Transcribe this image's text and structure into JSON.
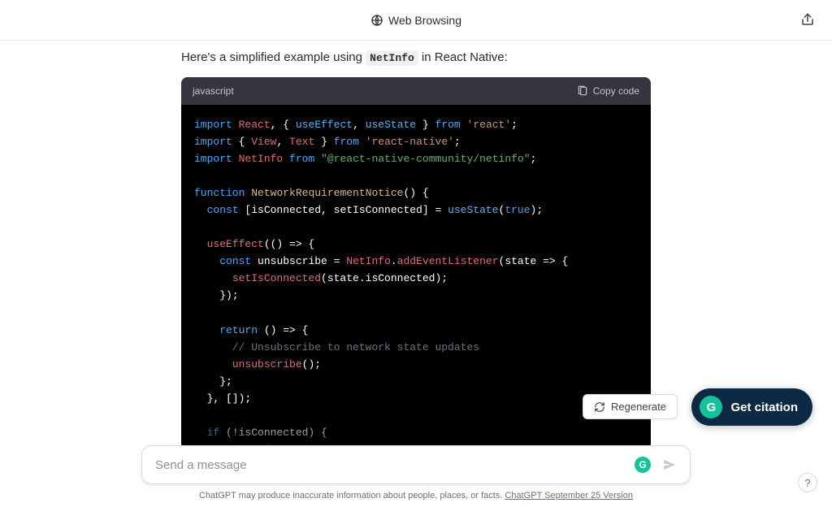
{
  "header": {
    "title": "Web Browsing"
  },
  "message": {
    "intro_pre": "Here's a simplified example using ",
    "intro_code": "NetInfo",
    "intro_post": " in React Native:"
  },
  "codeblock": {
    "language": "javascript",
    "copy_label": "Copy code",
    "lines": {
      "l1_kw_import": "import",
      "l1_react": "React",
      "l1_comma": ", { ",
      "l1_useeffect": "useEffect",
      "l1_sep1": ", ",
      "l1_usestate": "useState",
      "l1_close": " } ",
      "l1_kw_from": "from",
      "l1_str": "'react'",
      "l1_semi": ";",
      "l2_kw_import": "import",
      "l2_open": " { ",
      "l2_view": "View",
      "l2_sep": ", ",
      "l2_text": "Text",
      "l2_close": " } ",
      "l2_kw_from": "from",
      "l2_str": "'react-native'",
      "l2_semi": ";",
      "l3_kw_import": "import",
      "l3_sp": " ",
      "l3_netinfo": "NetInfo",
      "l3_sp2": " ",
      "l3_kw_from": "from",
      "l3_str": "\"@react-native-community/netinfo\"",
      "l3_semi": ";",
      "l5_kw_fn": "function",
      "l5_name": "NetworkRequirementNotice",
      "l5_rest": "() {",
      "l6_indent": "  ",
      "l6_kw_const": "const",
      "l6_destr": " [isConnected, setIsConnected] = ",
      "l6_usestate": "useState",
      "l6_open": "(",
      "l6_true": "true",
      "l6_close": ");",
      "l8_indent": "  ",
      "l8_useeffect": "useEffect",
      "l8_rest": "(() => {",
      "l9_indent": "    ",
      "l9_kw_const": "const",
      "l9_rest1": " unsubscribe = ",
      "l9_netinfo": "NetInfo",
      "l9_dot": ".",
      "l9_add": "addEventListener",
      "l9_rest2": "(state => {",
      "l10_indent": "      ",
      "l10_set": "setIsConnected",
      "l10_rest": "(state.isConnected);",
      "l11": "    });",
      "l13_indent": "    ",
      "l13_kw_return": "return",
      "l13_rest": " () => {",
      "l14_indent": "      ",
      "l14_comment": "// Unsubscribe to network state updates",
      "l15_indent": "      ",
      "l15_unsub": "unsubscribe",
      "l15_rest": "();",
      "l16": "    };",
      "l17": "  }, []);",
      "l19_indent": "  ",
      "l19_kw_if": "if",
      "l19_rest": " (!isConnected) {",
      "l20_indent": "    ",
      "l20_kw_return": "return",
      "l20_rest": " ("
    }
  },
  "actions": {
    "regenerate": "Regenerate",
    "get_citation": "Get citation"
  },
  "composer": {
    "placeholder": "Send a message"
  },
  "footer": {
    "disclaimer": "ChatGPT may produce inaccurate information about people, places, or facts. ",
    "version_link": "ChatGPT September 25 Version"
  },
  "help": {
    "label": "?"
  }
}
